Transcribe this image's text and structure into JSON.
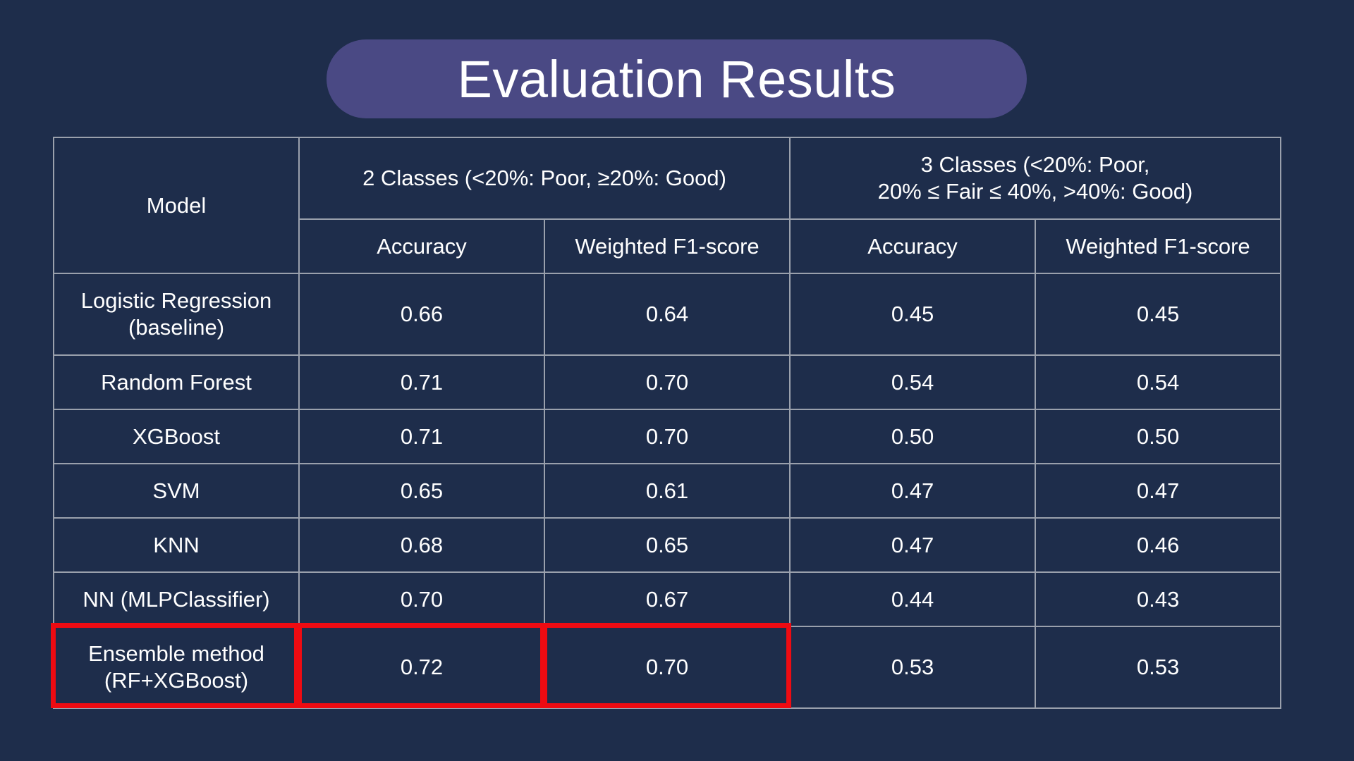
{
  "title": "Evaluation Results",
  "table": {
    "model_header": "Model",
    "group_2_classes": "2 Classes (<20%: Poor, ≥20%: Good)",
    "group_3_classes_line1": "3 Classes (<20%: Poor,",
    "group_3_classes_line2": "20% ≤ Fair ≤ 40%, >40%: Good)",
    "metric_accuracy": "Accuracy",
    "metric_f1": "Weighted F1-score",
    "rows": [
      {
        "model_line1": "Logistic Regression",
        "model_line2": "(baseline)",
        "acc2": "0.66",
        "f1_2": "0.64",
        "acc3": "0.45",
        "f1_3": "0.45"
      },
      {
        "model_line1": "Random Forest",
        "model_line2": "",
        "acc2": "0.71",
        "f1_2": "0.70",
        "acc3": "0.54",
        "f1_3": "0.54"
      },
      {
        "model_line1": "XGBoost",
        "model_line2": "",
        "acc2": "0.71",
        "f1_2": "0.70",
        "acc3": "0.50",
        "f1_3": "0.50"
      },
      {
        "model_line1": "SVM",
        "model_line2": "",
        "acc2": "0.65",
        "f1_2": "0.61",
        "acc3": "0.47",
        "f1_3": "0.47"
      },
      {
        "model_line1": "KNN",
        "model_line2": "",
        "acc2": "0.68",
        "f1_2": "0.65",
        "acc3": "0.47",
        "f1_3": "0.46"
      },
      {
        "model_line1": "NN (MLPClassifier)",
        "model_line2": "",
        "acc2": "0.70",
        "f1_2": "0.67",
        "acc3": "0.44",
        "f1_3": "0.43"
      },
      {
        "model_line1": "Ensemble method",
        "model_line2": "(RF+XGBoost)",
        "acc2": "0.72",
        "f1_2": "0.70",
        "acc3": "0.53",
        "f1_3": "0.53"
      }
    ]
  },
  "colors": {
    "background": "#1e2d4b",
    "title_pill": "#4a4984",
    "grid": "#9aa0ac",
    "highlight": "#ee0b12"
  }
}
